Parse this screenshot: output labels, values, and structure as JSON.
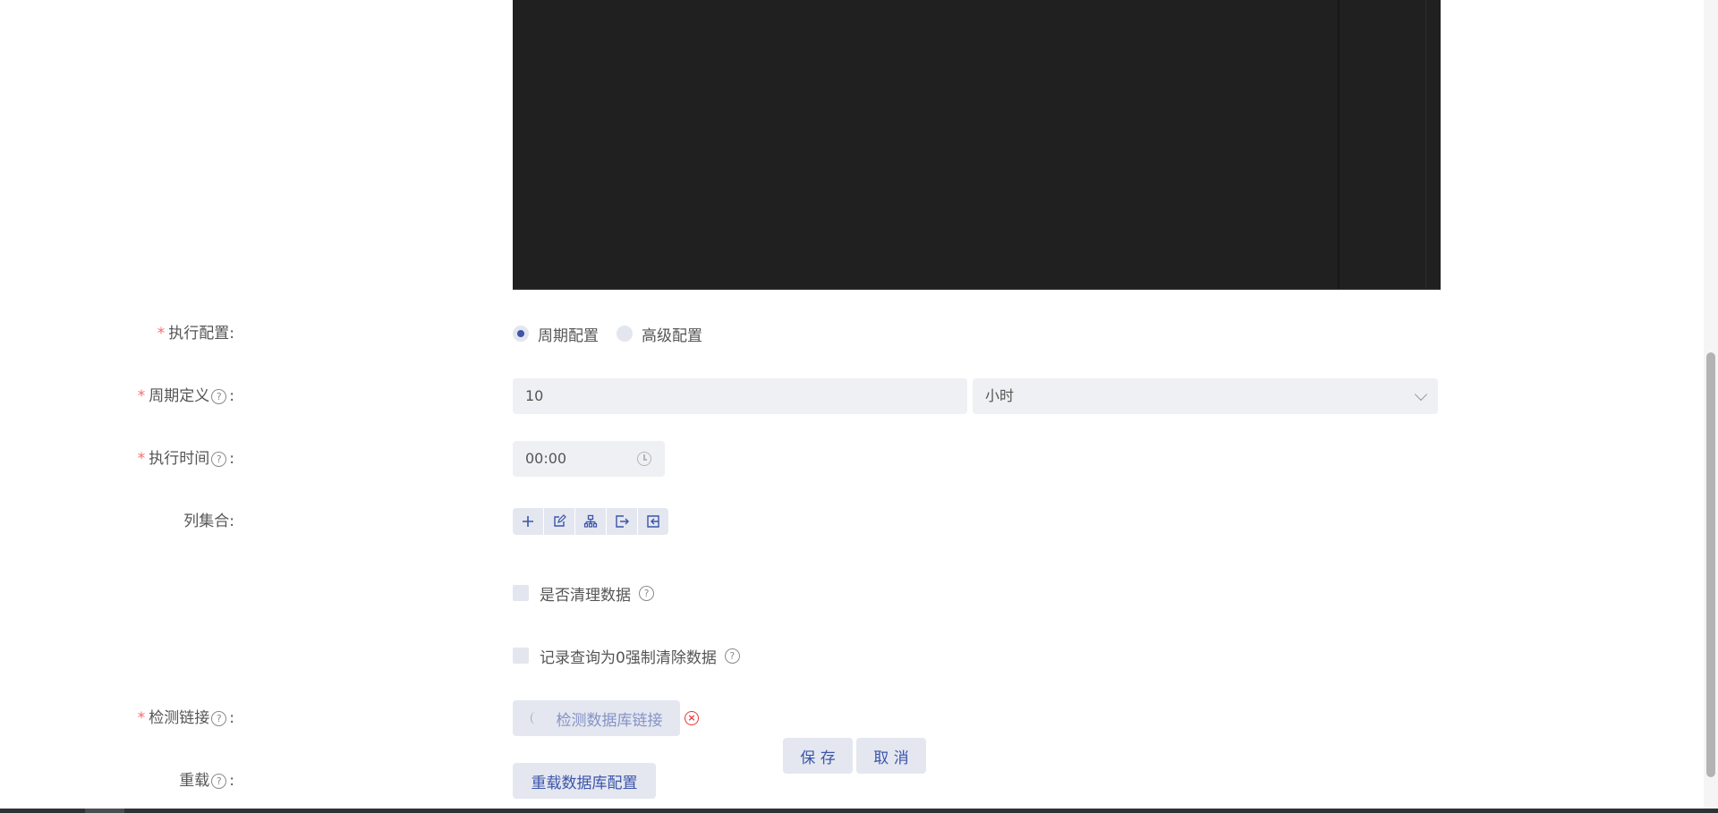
{
  "form": {
    "exec_config": {
      "label": "执行配置:",
      "options": [
        "周期配置",
        "高级配置"
      ],
      "selected": "周期配置"
    },
    "period": {
      "label": "周期定义",
      "value": "10",
      "unit": "小时"
    },
    "exec_time": {
      "label": "执行时间",
      "value": "00:00"
    },
    "columns": {
      "label": "列集合:",
      "tools": [
        "add-icon",
        "edit-icon",
        "tree-icon",
        "export-icon",
        "import-icon"
      ]
    },
    "clear_data": {
      "label": "是否清理数据"
    },
    "force_clear": {
      "label": "记录查询为0强制清除数据"
    },
    "detect_link": {
      "label": "检测链接",
      "button": "检测数据库链接"
    },
    "reload": {
      "label": "重载",
      "button": "重载数据库配置"
    }
  },
  "actions": {
    "save": "保 存",
    "cancel": "取 消"
  },
  "colors": {
    "accent": "#3b55a9",
    "required": "#f56c6c",
    "error": "#e53935",
    "editor_bg": "#202020"
  }
}
